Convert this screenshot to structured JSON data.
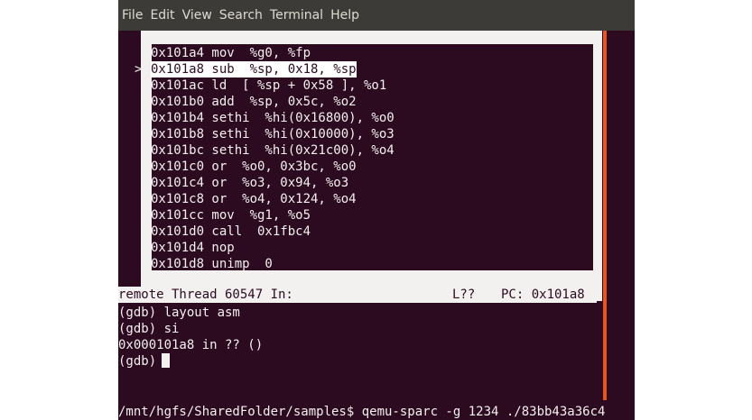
{
  "menu": [
    "File",
    "Edit",
    "View",
    "Search",
    "Terminal",
    "Help"
  ],
  "asm": {
    "pointer": ">",
    "current_index": 1,
    "lines": [
      "0x101a4 mov  %g0, %fp",
      "0x101a8 sub  %sp, 0x18, %sp",
      "0x101ac ld  [ %sp + 0x58 ], %o1",
      "0x101b0 add  %sp, 0x5c, %o2",
      "0x101b4 sethi  %hi(0x16800), %o0",
      "0x101b8 sethi  %hi(0x10000), %o3",
      "0x101bc sethi  %hi(0x21c00), %o4",
      "0x101c0 or  %o0, 0x3bc, %o0",
      "0x101c4 or  %o3, 0x94, %o3",
      "0x101c8 or  %o4, 0x124, %o4",
      "0x101cc mov  %g1, %o5",
      "0x101d0 call  0x1fbc4",
      "0x101d4 nop",
      "0x101d8 unimp  0"
    ]
  },
  "status": {
    "thread": "remote Thread 60547 In:",
    "line": "L??",
    "pc": "PC: 0x101a8"
  },
  "console": [
    "(gdb) layout asm",
    "(gdb) si",
    "0x000101a8 in ?? ()",
    "(gdb)"
  ],
  "shell_line": "/mnt/hgfs/SharedFolder/samples$ qemu-sparc -g 1234 ./83bb43a36c4",
  "colors": {
    "terminal_bg": "#2c0a1f",
    "scrollbar": "#e95420",
    "menubar": "#3c3b37"
  }
}
